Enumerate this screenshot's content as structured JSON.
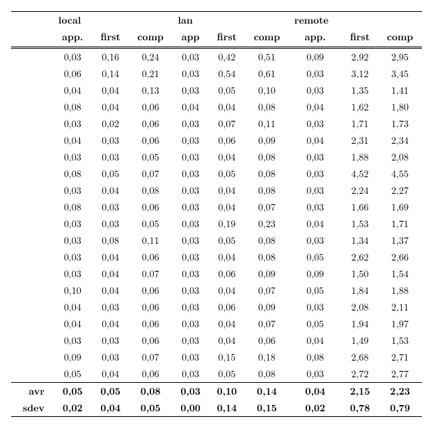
{
  "chart_data": {
    "type": "table",
    "header_row1": [
      "",
      "local",
      "",
      "",
      "lan",
      "",
      "",
      "remote",
      "",
      ""
    ],
    "header_row2": [
      "",
      "app.",
      "first",
      "comp",
      "app",
      "first",
      "comp",
      "app.",
      "first",
      "comp"
    ],
    "rows": [
      [
        "",
        "0,03",
        "0,16",
        "0,24",
        "0,03",
        "0,42",
        "0,51",
        "0,09",
        "2,92",
        "2,95"
      ],
      [
        "",
        "0,06",
        "0,14",
        "0,21",
        "0,03",
        "0,54",
        "0,61",
        "0,03",
        "3,12",
        "3,45"
      ],
      [
        "",
        "0,04",
        "0,04",
        "0,13",
        "0,03",
        "0,05",
        "0,10",
        "0,03",
        "1,35",
        "1,41"
      ],
      [
        "",
        "0,08",
        "0,04",
        "0,06",
        "0,04",
        "0,04",
        "0,08",
        "0,04",
        "1,62",
        "1,80"
      ],
      [
        "",
        "0,03",
        "0,02",
        "0,06",
        "0,03",
        "0,07",
        "0,11",
        "0,03",
        "1,71",
        "1,73"
      ],
      [
        "",
        "0,04",
        "0,03",
        "0,06",
        "0,03",
        "0,06",
        "0,09",
        "0,04",
        "2,31",
        "2,34"
      ],
      [
        "",
        "0,03",
        "0,03",
        "0,05",
        "0,03",
        "0,04",
        "0,08",
        "0,03",
        "1,88",
        "2,08"
      ],
      [
        "",
        "0,08",
        "0,05",
        "0,07",
        "0,03",
        "0,05",
        "0,08",
        "0,03",
        "4,52",
        "4,55"
      ],
      [
        "",
        "0,03",
        "0,04",
        "0,08",
        "0,03",
        "0,04",
        "0,08",
        "0,03",
        "2,24",
        "2,27"
      ],
      [
        "",
        "0,08",
        "0,03",
        "0,06",
        "0,03",
        "0,04",
        "0,07",
        "0,03",
        "1,66",
        "1,69"
      ],
      [
        "",
        "0,03",
        "0,03",
        "0,05",
        "0,03",
        "0,19",
        "0,23",
        "0,04",
        "1,53",
        "1,71"
      ],
      [
        "",
        "0,03",
        "0,08",
        "0,11",
        "0,03",
        "0,05",
        "0,08",
        "0,03",
        "1,34",
        "1,37"
      ],
      [
        "",
        "0,03",
        "0,04",
        "0,06",
        "0,03",
        "0,04",
        "0,08",
        "0,05",
        "2,62",
        "2,66"
      ],
      [
        "",
        "0,03",
        "0,04",
        "0,07",
        "0,03",
        "0,06",
        "0,09",
        "0,09",
        "1,50",
        "1,54"
      ],
      [
        "",
        "0,10",
        "0,04",
        "0,06",
        "0,03",
        "0,04",
        "0,07",
        "0,05",
        "1,84",
        "1,88"
      ],
      [
        "",
        "0,04",
        "0,03",
        "0,06",
        "0,03",
        "0,06",
        "0,09",
        "0,03",
        "2,08",
        "2,11"
      ],
      [
        "",
        "0,04",
        "0,04",
        "0,06",
        "0,03",
        "0,04",
        "0,07",
        "0,05",
        "1,94",
        "1,97"
      ],
      [
        "",
        "0,03",
        "0,03",
        "0,06",
        "0,03",
        "0,04",
        "0,06",
        "0,04",
        "1,49",
        "1,53"
      ],
      [
        "",
        "0,09",
        "0,03",
        "0,07",
        "0,03",
        "0,15",
        "0,18",
        "0,08",
        "2,68",
        "2,71"
      ],
      [
        "",
        "0,05",
        "0,04",
        "0,06",
        "0,03",
        "0,05",
        "0,08",
        "0,03",
        "2,72",
        "2,77"
      ]
    ],
    "summary": [
      [
        "avr",
        "0,05",
        "0,05",
        "0,08",
        "0,03",
        "0,10",
        "0,14",
        "0,04",
        "2,15",
        "2,23"
      ],
      [
        "sdev",
        "0,02",
        "0,04",
        "0,05",
        "0,00",
        "0,14",
        "0,15",
        "0,02",
        "0,78",
        "0,79"
      ]
    ]
  }
}
